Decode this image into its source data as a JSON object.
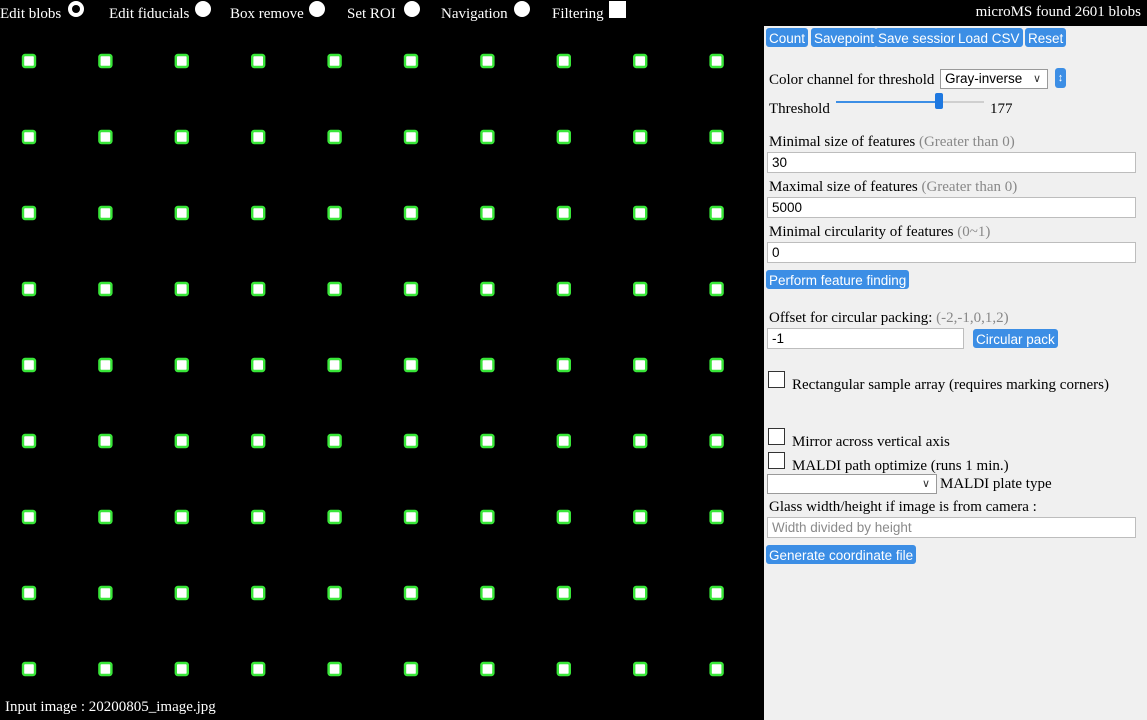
{
  "modes": [
    {
      "label": "Edit blobs",
      "control": "radio",
      "selected": true
    },
    {
      "label": "Edit fiducials",
      "control": "radio",
      "selected": false
    },
    {
      "label": "Box remove",
      "control": "radio",
      "selected": false
    },
    {
      "label": "Set ROI",
      "control": "radio",
      "selected": false
    },
    {
      "label": "Navigation",
      "control": "radio",
      "selected": false
    },
    {
      "label": "Filtering",
      "control": "checkbox",
      "selected": false
    }
  ],
  "status": {
    "blob_count": "microMS found 2601 blobs"
  },
  "canvas": {
    "input_image": "Input image : 20200805_image.jpg",
    "blob_color": "#39e639",
    "background": "#000000",
    "grid_cols": 10,
    "grid_rows": 9
  },
  "toolbar": {
    "count": "Count",
    "savepoint": "Savepoint",
    "save_session": "Save session",
    "load_csv": "Load CSV",
    "reset": "Reset"
  },
  "threshold": {
    "color_channel_label": "Color channel for threshold",
    "color_channel_value": "Gray-inverse",
    "sort_icon": "up-down-arrow-icon",
    "label": "Threshold",
    "value": "177",
    "max": 255
  },
  "features": {
    "min_size_label": "Minimal size of features",
    "min_size_hint": "(Greater than 0)",
    "min_size_value": "30",
    "max_size_label": "Maximal size of features",
    "max_size_hint": "(Greater than 0)",
    "max_size_value": "5000",
    "circularity_label": "Minimal circularity of features",
    "circularity_hint": "(0~1)",
    "circularity_value": "0",
    "perform_button": "Perform feature finding"
  },
  "packing": {
    "offset_label": "Offset for circular packing:",
    "offset_hint": "(-2,-1,0,1,2)",
    "offset_value": "-1",
    "circular_pack_button": "Circular pack"
  },
  "options": {
    "rectangular_label": "Rectangular sample array (requires marking corners)",
    "mirror_label": "Mirror across vertical axis",
    "maldi_optimize_label": "MALDI path optimize (runs 1 min.)",
    "maldi_plate_label": "MALDI plate type",
    "maldi_plate_value": ""
  },
  "glass": {
    "label": "Glass width/height if image is from camera :",
    "placeholder": "Width divided by height",
    "generate_button": "Generate coordinate file"
  },
  "colors": {
    "accent": "#3c8ee5",
    "panel_bg": "#f0f0f0"
  }
}
